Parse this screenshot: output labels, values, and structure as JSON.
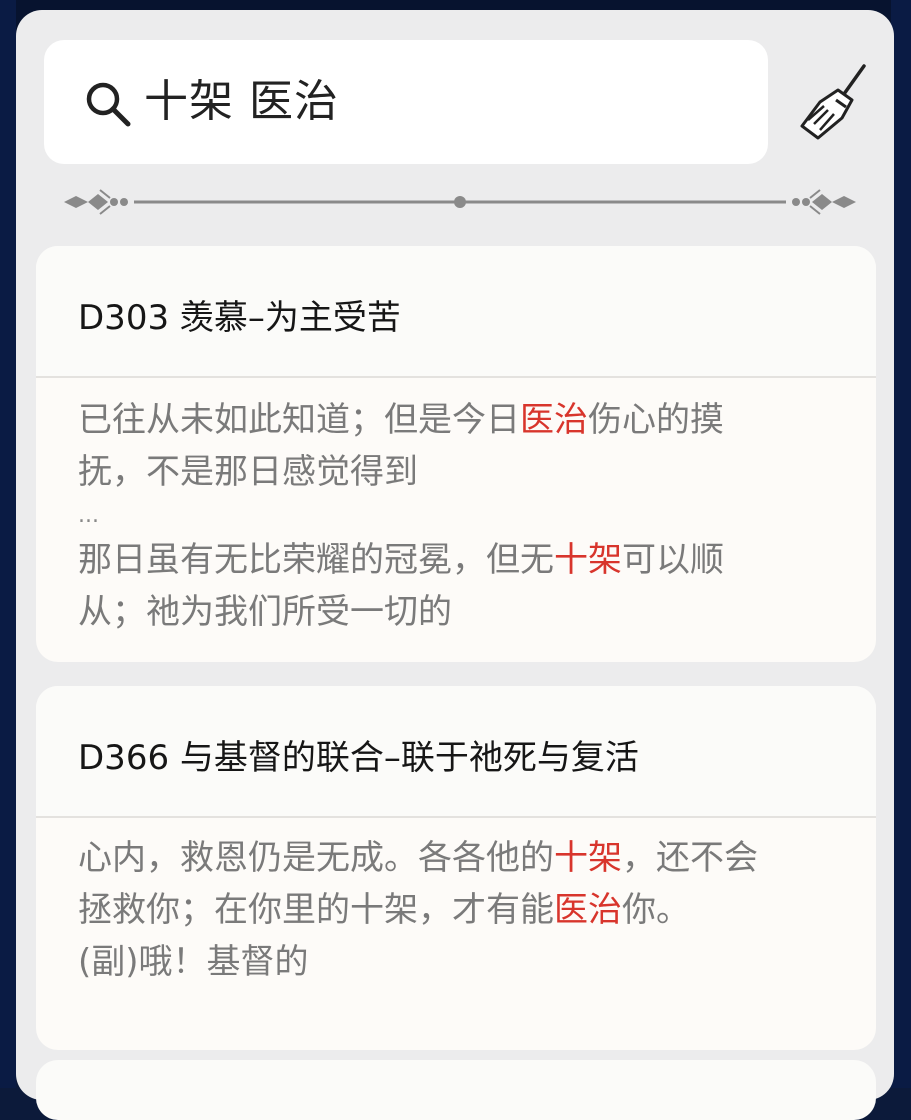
{
  "search": {
    "query": "十架 医治"
  },
  "icons": {
    "search": "search-icon",
    "clear": "broom-icon",
    "divider": "ornament-divider"
  },
  "colors": {
    "highlight": "#d8352c",
    "background": "#0c1a3a",
    "panel": "#ececed"
  },
  "results": [
    {
      "title": "D303 羡慕–为主受苦",
      "lines": [
        [
          {
            "t": "已往从未如此知道；但是今日"
          },
          {
            "t": "医治",
            "hl": true
          },
          {
            "t": "伤心的摸"
          }
        ],
        [
          {
            "t": "抚，不是那日感觉得到"
          }
        ],
        [
          {
            "t": "...",
            "ellipsis": true
          }
        ],
        [
          {
            "t": "那日虽有无比荣耀的冠冕，但无"
          },
          {
            "t": "十架",
            "hl": true
          },
          {
            "t": "可以顺"
          }
        ],
        [
          {
            "t": "从；祂为我们所受一切的"
          }
        ]
      ]
    },
    {
      "title": "D366 与基督的联合–联于祂死与复活",
      "lines": [
        [
          {
            "t": "心内，救恩仍是无成。各各他的"
          },
          {
            "t": "十架",
            "hl": true
          },
          {
            "t": "，还不会"
          }
        ],
        [
          {
            "t": "拯救你；在你里的十架，才有能"
          },
          {
            "t": "医治",
            "hl": true
          },
          {
            "t": "你。"
          }
        ],
        [
          {
            "t": " "
          }
        ],
        [
          {
            "t": "(副)哦！基督的"
          }
        ]
      ]
    }
  ]
}
